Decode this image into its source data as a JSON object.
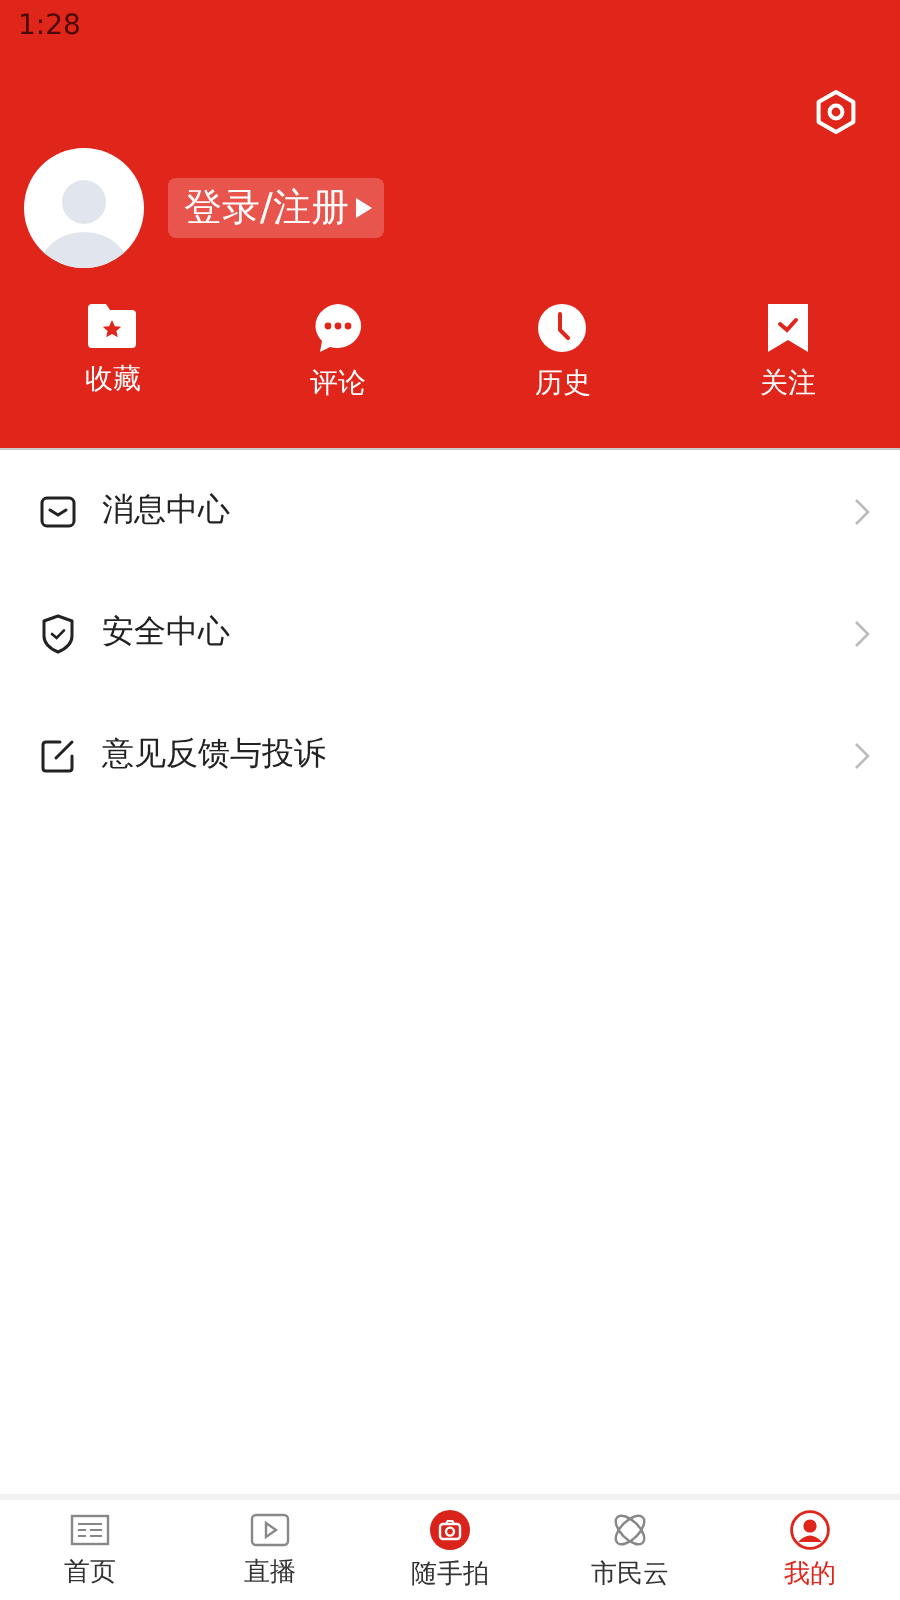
{
  "status_bar": {
    "time": "1:28"
  },
  "profile": {
    "login_label": "登录/注册"
  },
  "shortcuts": [
    {
      "kind": "favorites",
      "label": "收藏"
    },
    {
      "kind": "comments",
      "label": "评论"
    },
    {
      "kind": "history",
      "label": "历史"
    },
    {
      "kind": "follow",
      "label": "关注"
    }
  ],
  "menu": [
    {
      "kind": "messages",
      "label": "消息中心"
    },
    {
      "kind": "security",
      "label": "安全中心"
    },
    {
      "kind": "feedback",
      "label": "意见反馈与投诉"
    }
  ],
  "tab_bar": [
    {
      "kind": "home",
      "label": "首页",
      "selected": false
    },
    {
      "kind": "live",
      "label": "直播",
      "selected": false
    },
    {
      "kind": "camera",
      "label": "随手拍",
      "selected": false
    },
    {
      "kind": "cloud",
      "label": "市民云",
      "selected": false
    },
    {
      "kind": "me",
      "label": "我的",
      "selected": true
    }
  ]
}
